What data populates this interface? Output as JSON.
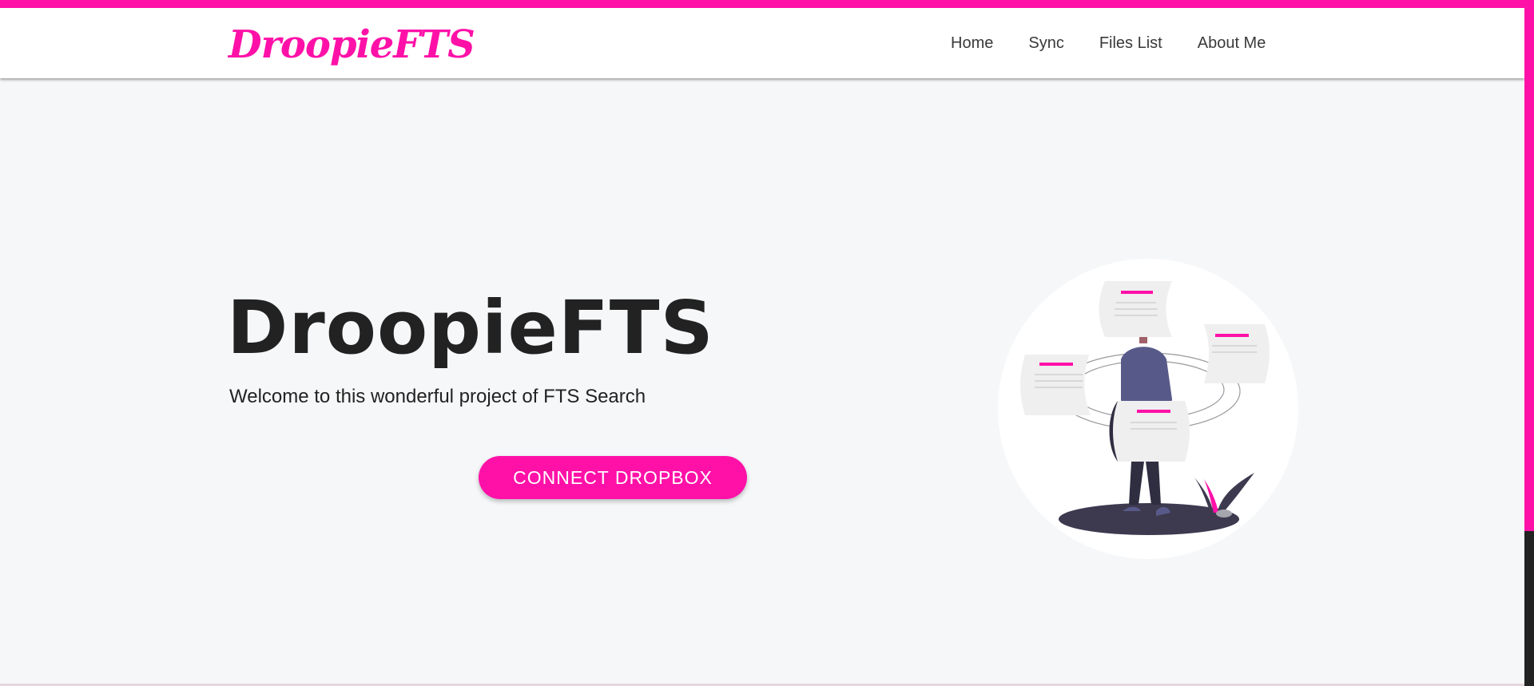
{
  "brand": {
    "name": "DroopieFTS"
  },
  "nav": {
    "items": [
      {
        "label": "Home"
      },
      {
        "label": "Sync"
      },
      {
        "label": "Files List"
      },
      {
        "label": "About Me"
      }
    ]
  },
  "hero": {
    "title": "DroopieFTS",
    "subtitle": "Welcome to this wonderful project of FTS Search",
    "cta_label": "CONNECT DROPBOX"
  },
  "illustration": {
    "icon": "person-with-documents-illustration"
  },
  "colors": {
    "accent": "#ff11a8",
    "background": "#f6f7f9",
    "navbar": "#ffffff",
    "text": "#222222"
  }
}
